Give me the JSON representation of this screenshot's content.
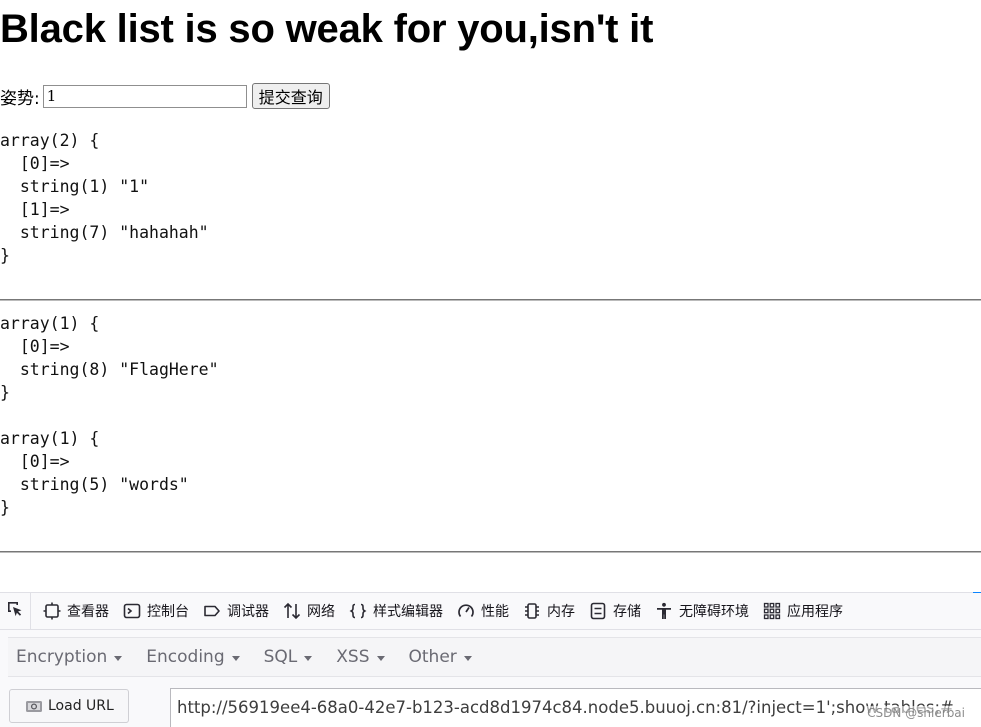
{
  "page": {
    "heading": "Black list is so weak for you,isn't it",
    "form": {
      "label": "姿势:",
      "input_value": "1",
      "submit_label": "提交查询"
    },
    "dumps": [
      "array(2) {\n  [0]=>\n  string(1) \"1\"\n  [1]=>\n  string(7) \"hahahah\"\n}",
      "array(1) {\n  [0]=>\n  string(8) \"FlagHere\"\n}",
      "array(1) {\n  [0]=>\n  string(5) \"words\"\n}"
    ]
  },
  "devtools": {
    "accent_color": "#0a84ff",
    "tabs": [
      {
        "label": "查看器",
        "icon": "inspector-icon"
      },
      {
        "label": "控制台",
        "icon": "console-icon"
      },
      {
        "label": "调试器",
        "icon": "debugger-icon"
      },
      {
        "label": "网络",
        "icon": "network-icon"
      },
      {
        "label": "样式编辑器",
        "icon": "style-editor-icon"
      },
      {
        "label": "性能",
        "icon": "performance-icon"
      },
      {
        "label": "内存",
        "icon": "memory-icon"
      },
      {
        "label": "存储",
        "icon": "storage-icon"
      },
      {
        "label": "无障碍环境",
        "icon": "accessibility-icon"
      },
      {
        "label": "应用程序",
        "icon": "application-icon"
      }
    ]
  },
  "hackbar": {
    "menus": [
      "Encryption",
      "Encoding",
      "SQL",
      "XSS",
      "Other"
    ],
    "load_url_label": "Load URL",
    "url_value": "http://56919ee4-68a0-42e7-b123-acd8d1974c84.node5.buuoj.cn:81/?inject=1';show tables;#"
  },
  "watermark": "CSDN @shierbai"
}
